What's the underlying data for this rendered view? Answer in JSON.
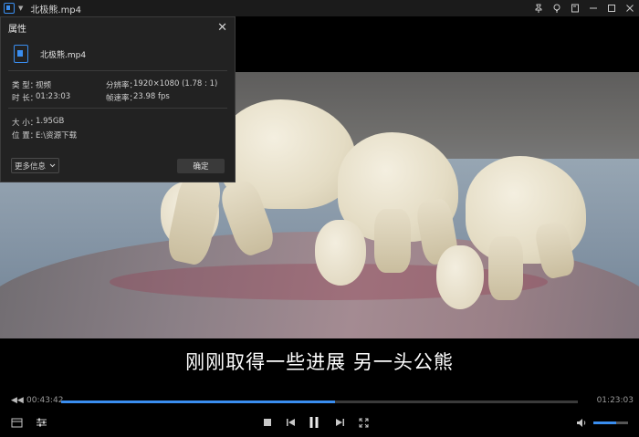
{
  "window": {
    "title": "北极熊.mp4",
    "controls": [
      "pin-icon",
      "lightbulb-icon",
      "screenshot-icon",
      "minimize-icon",
      "maximize-icon",
      "close-icon"
    ]
  },
  "dialog": {
    "title": "属性",
    "file_name": "北极熊.mp4",
    "type_label": "类 型：",
    "type_value": "视频",
    "duration_label": "时 长：",
    "duration_value": "01:23:03",
    "resolution_label": "分辨率：",
    "resolution_value": "1920×1080 (1.78 : 1)",
    "framerate_label": "帧速率：",
    "framerate_value": "23.98 fps",
    "size_label": "大 小：",
    "size_value": "1.95GB",
    "location_label": "位 置：",
    "location_value": "E:\\资源下载",
    "more_label": "更多信息",
    "ok_label": "确定"
  },
  "subtitle": "刚刚取得一些进展 另一头公熊",
  "playback": {
    "current_time": "00:43:42",
    "total_time": "01:23:03",
    "progress": 0.53,
    "volume": 0.65
  },
  "colors": {
    "accent": "#3a8ef0",
    "titlebar": "#1b1b1b",
    "dialog_bg": "#222222"
  }
}
